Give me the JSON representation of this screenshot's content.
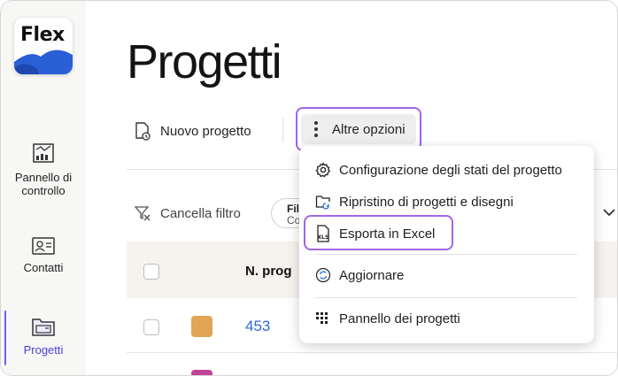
{
  "app": {
    "logo_text": "Flex"
  },
  "sidebar": {
    "items": [
      {
        "label_line1": "Pannello di",
        "label_line2": "controllo",
        "icon": "dashboard-chart-icon"
      },
      {
        "label": "Contatti",
        "icon": "contact-card-icon"
      },
      {
        "label": "Progetti",
        "icon": "folder-icon",
        "active": true
      }
    ]
  },
  "page": {
    "title": "Progetti"
  },
  "toolbar": {
    "new_project_label": "Nuovo progetto",
    "more_options_label": "Altre opzioni"
  },
  "filters": {
    "clear_label": "Cancella filtro",
    "filter_title": "Fil",
    "filter_value": "Co"
  },
  "table": {
    "columns": [
      "N. prog"
    ],
    "rows": [
      {
        "number": "453",
        "color": "#e0a654"
      }
    ],
    "next_row_color": "#c0439a"
  },
  "dropdown": {
    "items": [
      {
        "label": "Configurazione degli stati del progetto",
        "icon": "gear-icon"
      },
      {
        "label": "Ripristino di progetti e disegni",
        "icon": "folder-restore-icon"
      },
      {
        "label": "Esporta in Excel",
        "icon": "xls-file-icon",
        "highlighted": true
      },
      {
        "label": "Aggiornare",
        "icon": "refresh-icon"
      },
      {
        "label": "Pannello dei progetti",
        "icon": "grid-dots-icon"
      }
    ]
  },
  "colors": {
    "accent_purple": "#a265e6",
    "active_nav": "#4a3fd8",
    "link_blue": "#2b6bd8",
    "logo_blue": "#2a5fd6"
  }
}
